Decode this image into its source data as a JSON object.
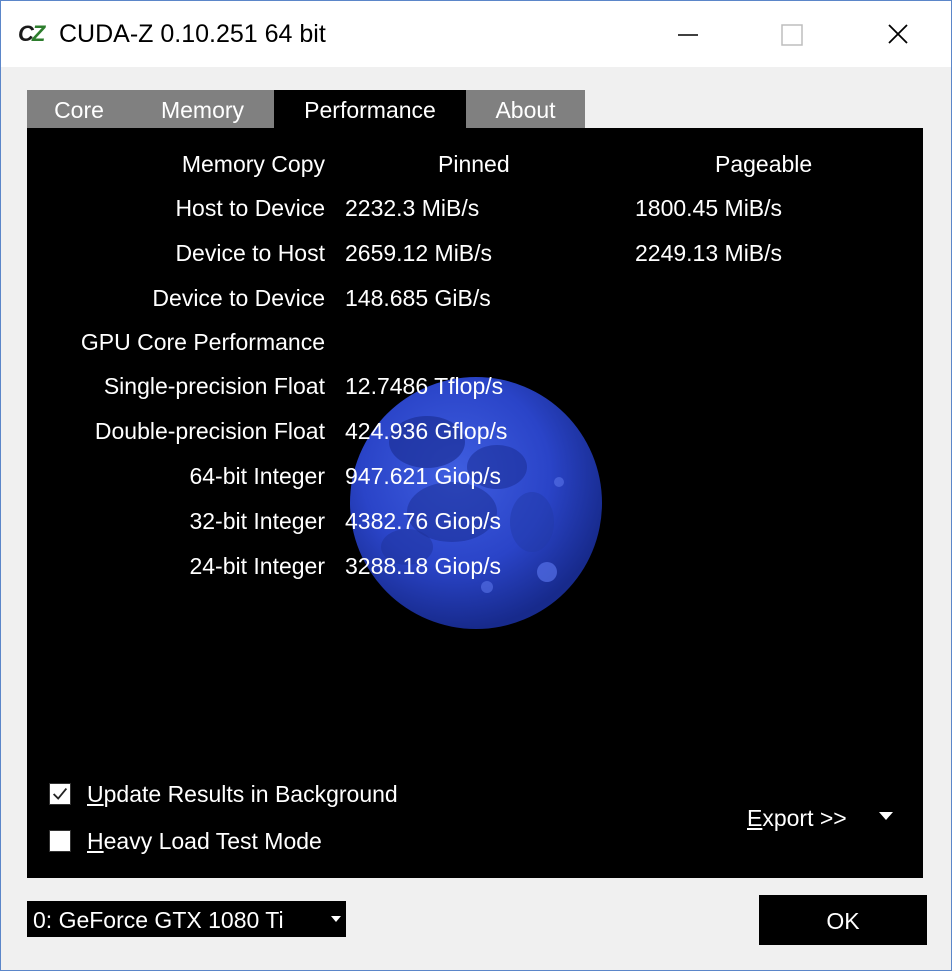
{
  "window": {
    "title": "CUDA-Z 0.10.251 64 bit",
    "icon_text": "CZ"
  },
  "tabs": [
    {
      "label": "Core",
      "active": false
    },
    {
      "label": "Memory",
      "active": false
    },
    {
      "label": "Performance",
      "active": true
    },
    {
      "label": "About",
      "active": false
    }
  ],
  "performance": {
    "memory_copy_label": "Memory Copy",
    "col_pinned": "Pinned",
    "col_pageable": "Pageable",
    "rows": [
      {
        "label": "Host to Device",
        "pinned": "2232.3 MiB/s",
        "pageable": "1800.45 MiB/s"
      },
      {
        "label": "Device to Host",
        "pinned": "2659.12 MiB/s",
        "pageable": "2249.13 MiB/s"
      },
      {
        "label": "Device to Device",
        "pinned": "148.685 GiB/s",
        "pageable": ""
      }
    ],
    "gpu_core_label": "GPU Core Performance",
    "core_rows": [
      {
        "label": "Single-precision Float",
        "value": "12.7486 Tflop/s"
      },
      {
        "label": "Double-precision Float",
        "value": "424.936 Gflop/s"
      },
      {
        "label": "64-bit Integer",
        "value": "947.621 Giop/s"
      },
      {
        "label": "32-bit Integer",
        "value": "4382.76 Giop/s"
      },
      {
        "label": "24-bit Integer",
        "value": "3288.18 Giop/s"
      }
    ]
  },
  "options": {
    "update_bg_label": "Update Results in Background",
    "update_bg_checked": true,
    "heavy_load_label": "Heavy Load Test Mode",
    "heavy_load_checked": false,
    "export_label": "Export >>"
  },
  "footer": {
    "device_selected": "0: GeForce GTX 1080 Ti",
    "ok_label": "OK"
  },
  "colors": {
    "tab_inactive": "#808080",
    "tab_active": "#000000",
    "panel_bg": "#000000",
    "moon_blue": "#2a44c8"
  }
}
